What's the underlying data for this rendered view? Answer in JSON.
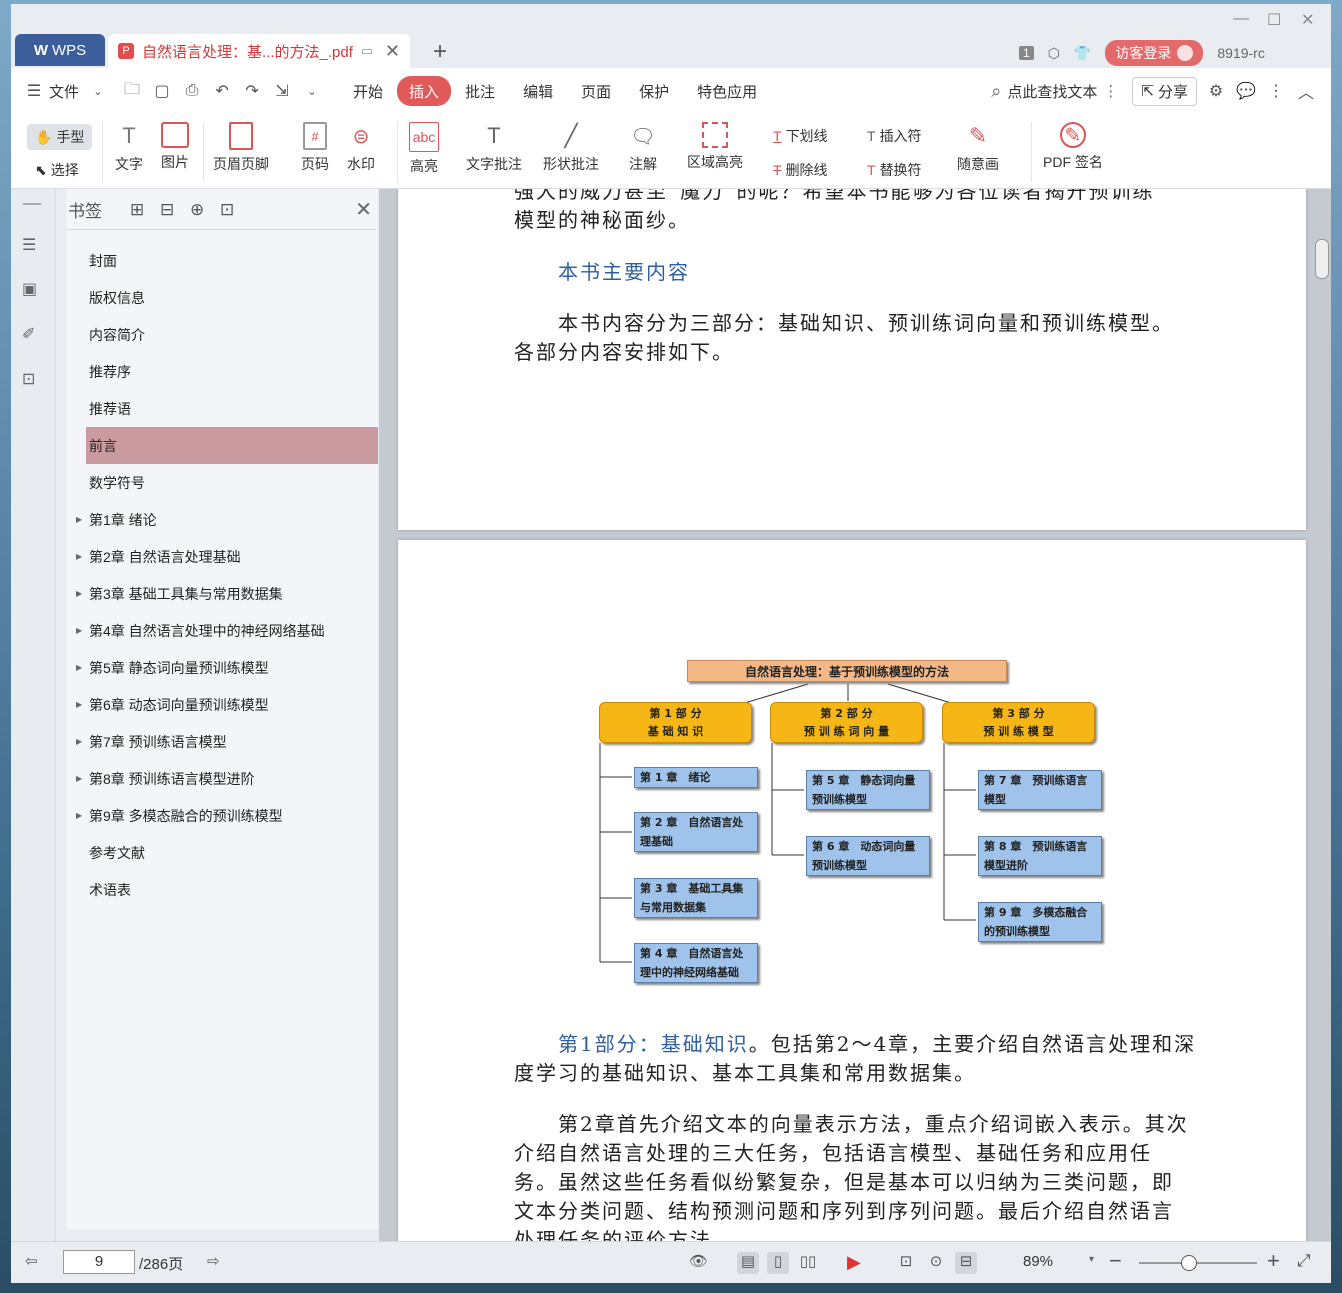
{
  "titlebar": {
    "app_tab": "WPS",
    "doc_tab": "自然语言处理：基...的方法_.pdf",
    "page_badge": "1",
    "login": "访客登录",
    "version": "8919-rc"
  },
  "menubar": {
    "file": "文件",
    "items": [
      "开始",
      "插入",
      "批注",
      "编辑",
      "页面",
      "保护",
      "特色应用"
    ],
    "search": "点此查找文本",
    "share": "分享"
  },
  "ribbon": {
    "hand": "手型",
    "select": "选择",
    "text": "文字",
    "image": "图片",
    "header_footer": "页眉页脚",
    "page_number": "页码",
    "watermark": "水印",
    "highlight": "高亮",
    "text_comment": "文字批注",
    "shape_comment": "形状批注",
    "annotation": "注解",
    "area_highlight": "区域高亮",
    "underline": "下划线",
    "strikethrough": "删除线",
    "insert_char": "插入符",
    "replace_char": "替换符",
    "freehand": "随意画",
    "pdf_sign": "PDF 签名"
  },
  "bookmarks": {
    "title": "书签",
    "items": [
      {
        "label": "封面",
        "expand": false
      },
      {
        "label": "版权信息",
        "expand": false
      },
      {
        "label": "内容简介",
        "expand": false
      },
      {
        "label": "推荐序",
        "expand": false
      },
      {
        "label": "推荐语",
        "expand": false
      },
      {
        "label": "前言",
        "expand": false,
        "selected": true
      },
      {
        "label": "数学符号",
        "expand": false
      },
      {
        "label": "第1章 绪论",
        "expand": true
      },
      {
        "label": "第2章 自然语言处理基础",
        "expand": true
      },
      {
        "label": "第3章 基础工具集与常用数据集",
        "expand": true
      },
      {
        "label": "第4章 自然语言处理中的神经网络基础",
        "expand": true
      },
      {
        "label": "第5章 静态词向量预训练模型",
        "expand": true
      },
      {
        "label": "第6章 动态词向量预训练模型",
        "expand": true
      },
      {
        "label": "第7章 预训练语言模型",
        "expand": true
      },
      {
        "label": "第8章 预训练语言模型进阶",
        "expand": true
      },
      {
        "label": "第9章 多模态融合的预训练模型",
        "expand": true
      },
      {
        "label": "参考文献",
        "expand": false
      },
      {
        "label": "术语表",
        "expand": false
      }
    ]
  },
  "page1": {
    "line1": "强大的威力甚至“魔力”的呢？希望本书能够为各位读者揭开预训练",
    "line2": "模型的神秘面纱。",
    "heading": "本书主要内容",
    "para_line1": "本书内容分为三部分：基础知识、预训练词向量和预训练模型。",
    "para_line2": "各部分内容安排如下。"
  },
  "diagram": {
    "top": "自然语言处理：基于预训练模型的方法",
    "parts": [
      {
        "l1": "第 1 部 分",
        "l2": "基 础 知 识"
      },
      {
        "l1": "第 2 部 分",
        "l2": "预 训 练 词 向 量"
      },
      {
        "l1": "第 3 部 分",
        "l2": "预 训 练 模 型"
      }
    ],
    "chapters": {
      "c1": "第 1 章　绪论",
      "c2a": "第 2 章　自然语言处",
      "c2b": "理基础",
      "c3a": "第 3 章　基础工具集",
      "c3b": "与常用数据集",
      "c4a": "第 4 章　自然语言处",
      "c4b": "理中的神经网络基础",
      "c5a": "第 5 章　静态词向量",
      "c5b": "预训练模型",
      "c6a": "第 6 章　动态词向量",
      "c6b": "预训练模型",
      "c7a": "第 7 章　预训练语言",
      "c7b": "模型",
      "c8a": "第 8 章　预训练语言",
      "c8b": "模型进阶",
      "c9a": "第 9 章　多模态融合",
      "c9b": "的预训练模型"
    }
  },
  "page2": {
    "p1_blue": "第1部分：基础知识",
    "p1_rest": "。包括第2～4章，主要介绍自然语言处理和深",
    "p1_line2": "度学习的基础知识、基本工具集和常用数据集。",
    "p2_line1": "第2章首先介绍文本的向量表示方法，重点介绍词嵌入表示。其次",
    "p2_line2": "介绍自然语言处理的三大任务，包括语言模型、基础任务和应用任",
    "p2_line3": "务。虽然这些任务看似纷繁复杂，但是基本可以归纳为三类问题，即",
    "p2_line4": "文本分类问题、结构预测问题和序列到序列问题。最后介绍自然语言",
    "p2_line5": "处理任务的评价方法"
  },
  "status": {
    "page_current": "9",
    "page_total": "/286页",
    "zoom": "89%"
  },
  "colors": {
    "accent": "#e05a5a",
    "wps_tab": "#3c5f9c",
    "bookmark_selected": "#c99aa0",
    "part_box": "#f6b716",
    "chapter_box": "#9fc3ea",
    "top_box": "#f4b887"
  }
}
